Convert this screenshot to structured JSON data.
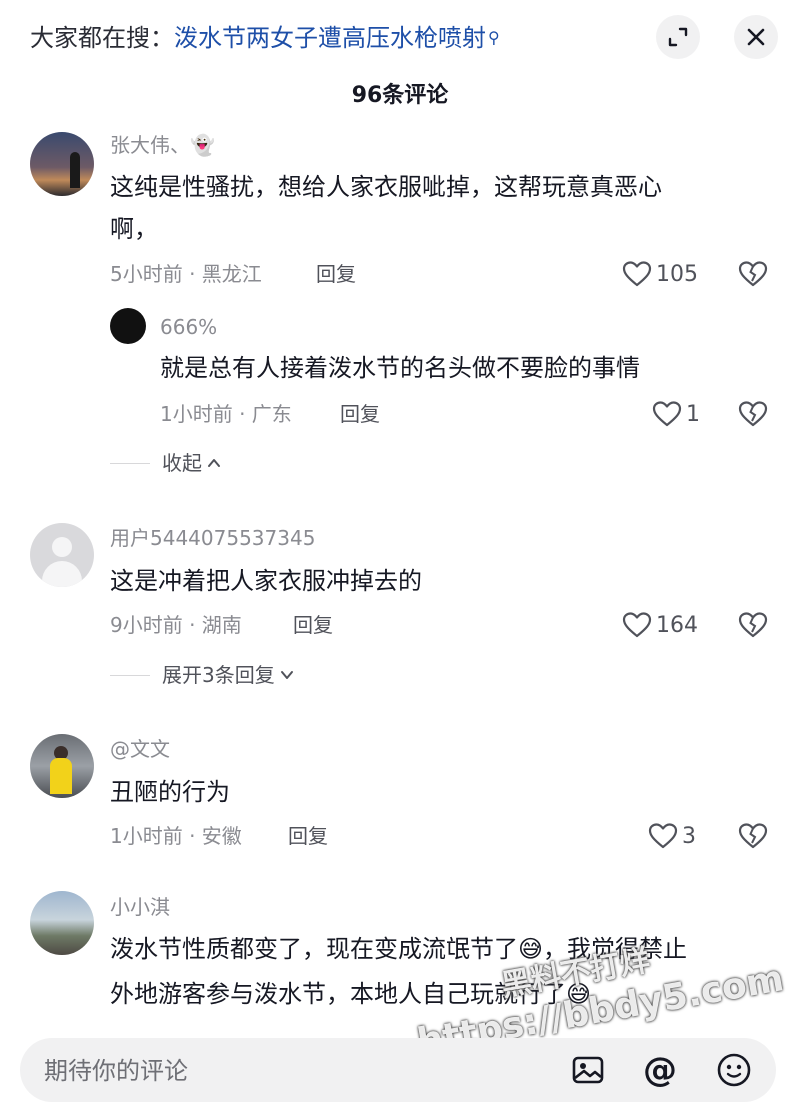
{
  "header": {
    "search_prefix": "大家都在搜：",
    "search_query": "泼水节两女子遭高压水枪喷射",
    "comment_count": "96条评论"
  },
  "comments": [
    {
      "name": "张大伟、👻",
      "text_line1": "这纯是性骚扰，想给人家衣服呲掉，这帮玩意真恶心",
      "text_line2": "啊，",
      "time": "5小时前 · 黑龙江",
      "reply_label": "回复",
      "likes": "105",
      "sub_reply": {
        "name": "666%",
        "text": "就是总有人接着泼水节的名头做不要脸的事情",
        "time": "1小时前 · 广东",
        "reply_label": "回复",
        "likes": "1"
      },
      "toggle_label": "收起"
    },
    {
      "name": "用户5444075537345",
      "text": "这是冲着把人家衣服冲掉去的",
      "time": "9小时前 · 湖南",
      "reply_label": "回复",
      "likes": "164",
      "toggle_label": "展开3条回复"
    },
    {
      "name": "@文文",
      "text": "丑陋的行为",
      "time": "1小时前 · 安徽",
      "reply_label": "回复",
      "likes": "3"
    },
    {
      "name": "小小淇",
      "text_line1": "泼水节性质都变了，现在变成流氓节了😅，我觉得禁止",
      "text_line2": "外地游客参与泼水节，本地人自己玩就行了😅"
    }
  ],
  "input": {
    "placeholder": "期待你的评论"
  },
  "watermark": {
    "line1": "黑料不打烊",
    "line2": "https://bbdy5.com"
  },
  "colors": {
    "link": "#1e4fa8",
    "meta": "#8a8b91"
  },
  "icons": [
    "search-icon",
    "collapse-icon",
    "close-icon",
    "heart-icon",
    "dislike-icon",
    "chevron-up-icon",
    "chevron-down-icon",
    "image-icon",
    "mention-icon",
    "emoji-icon"
  ]
}
